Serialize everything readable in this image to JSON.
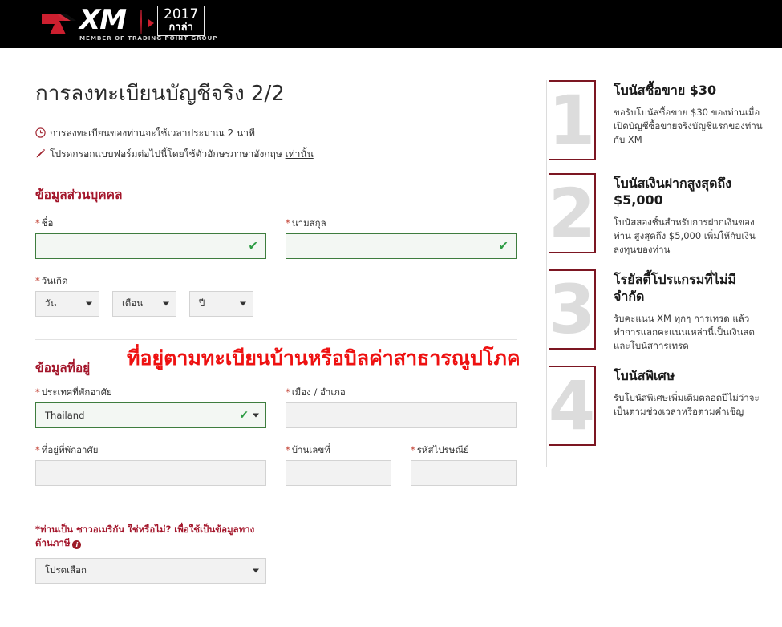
{
  "header": {
    "logo_text": "XM",
    "logo_subtitle": "MEMBER OF TRADING POINT GROUP",
    "badge_year": "2017",
    "badge_word": "กาล่า"
  },
  "form": {
    "page_title": "การลงทะเบียนบัญชีจริง 2/2",
    "notes": [
      {
        "icon": "clock-icon",
        "text": "การลงทะเบียนของท่านจะใช้เวลาประมาณ 2 นาที",
        "link": ""
      },
      {
        "icon": "pencil-icon",
        "text": "โปรดกรอกแบบฟอร์มต่อไปนี้โดยใช้ตัวอักษรภาษาอังกฤษ ",
        "link": "เท่านั้น"
      }
    ],
    "personal_section": {
      "title": "ข้อมูลส่วนบุคคล",
      "first_name": {
        "label": "ชื่อ",
        "value": "",
        "required": "*"
      },
      "last_name": {
        "label": "นามสกุล",
        "value": "",
        "required": "*"
      },
      "dob": {
        "label": "วันเกิด",
        "required": "*",
        "day": "วัน",
        "month": "เดือน",
        "year": "ปี"
      }
    },
    "address_section": {
      "title": "ข้อมูลที่อยู่",
      "annotation": "ที่อยู่ตามทะเบียนบ้านหรือบิลค่าสาธารณูปโภค",
      "country": {
        "label": "ประเทศที่พักอาศัย",
        "value": "Thailand",
        "required": "*"
      },
      "city": {
        "label": "เมือง / อำเภอ",
        "value": "",
        "required": "*"
      },
      "street": {
        "label": "ที่อยู่ที่พักอาศัย",
        "value": "",
        "required": "*"
      },
      "house_no": {
        "label": "บ้านเลขที่",
        "value": "",
        "required": "*"
      },
      "postal_code": {
        "label": "รหัสไปรษณีย์",
        "value": "",
        "required": "*"
      }
    },
    "tax_section": {
      "question": "*ท่านเป็น ชาวอเมริกัน ใช่หรือไม่? เพื่อใช้เป็นข้อมูลทางด้านภาษี",
      "select_value": "โปรดเลือก"
    }
  },
  "sidebar": {
    "bonuses": [
      {
        "number": "1",
        "title": "โบนัสซื้อขาย $30",
        "desc": "ขอรับโบนัสซื้อขาย $30 ของท่านเมื่อเปิดบัญชีซื้อขายจริงบัญชีแรกของท่านกับ XM"
      },
      {
        "number": "2",
        "title": "โบนัสเงินฝากสูงสุดถึง $5,000",
        "desc": "โบนัสสองชั้นสำหรับการฝากเงินของท่าน สูงสุดถึง $5,000 เพิ่มให้กับเงินลงทุนของท่าน"
      },
      {
        "number": "3",
        "title": "โรยัลตี้โปรแกรมที่ไม่มีจำกัด",
        "desc": "รับคะแนน XM ทุกๆ การเทรด แล้วทำการแลกคะแนนเหล่านี้เป็นเงินสดและโบนัสการเทรด"
      },
      {
        "number": "4",
        "title": "โบนัสพิเศษ",
        "desc": "รับโบนัสพิเศษเพิ่มเติมตลอดปีไม่ว่าจะเป็นตามช่วงเวลาหรือตามคำเชิญ"
      }
    ]
  },
  "colors": {
    "header_bg": "#000000",
    "brand_red": "#a3152a",
    "annotation_red": "#ee1111",
    "valid_green": "#3e7d3e",
    "check_green": "#2e9c45",
    "bracket_maroon": "#7c1622"
  }
}
